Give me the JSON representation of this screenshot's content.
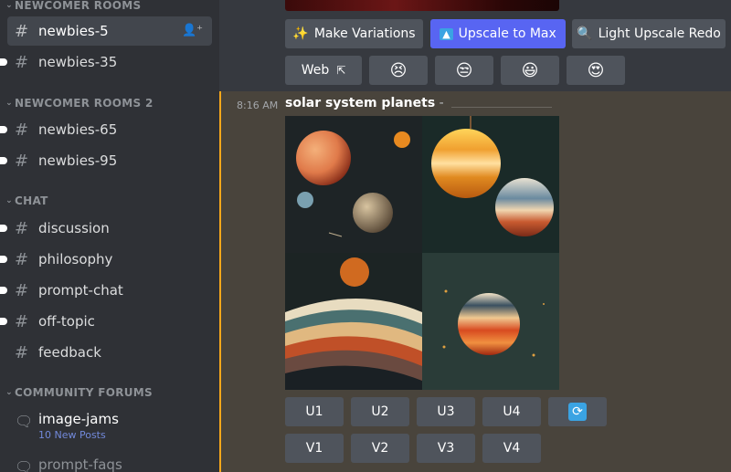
{
  "sidebar": {
    "categories": [
      {
        "label": "NEWCOMER ROOMS"
      },
      {
        "label": "NEWCOMER ROOMS 2"
      },
      {
        "label": "CHAT"
      },
      {
        "label": "COMMUNITY FORUMS"
      }
    ],
    "channels": [
      {
        "label": "newbies-5"
      },
      {
        "label": "newbies-35"
      },
      {
        "label": "newbies-65"
      },
      {
        "label": "newbies-95"
      },
      {
        "label": "discussion"
      },
      {
        "label": "philosophy"
      },
      {
        "label": "prompt-chat"
      },
      {
        "label": "off-topic"
      },
      {
        "label": "feedback"
      }
    ],
    "forums": [
      {
        "label": "image-jams",
        "sub": "10 New Posts"
      },
      {
        "label": "prompt-faqs"
      }
    ]
  },
  "message_top": {
    "buttons": {
      "make_variations": "Make Variations",
      "upscale_max": "Upscale to Max",
      "light_upscale": "Light Upscale Redo",
      "web": "Web"
    },
    "reactions": [
      "😣",
      "😒",
      "😃",
      "😍"
    ]
  },
  "message": {
    "time": "8:16 AM",
    "prompt": "solar system planets",
    "separator": "-",
    "buttons": {
      "u1": "U1",
      "u2": "U2",
      "u3": "U3",
      "u4": "U4",
      "v1": "V1",
      "v2": "V2",
      "v3": "V3",
      "v4": "V4"
    }
  },
  "colors": {
    "sidebar_bg": "#2f3136",
    "main_bg": "#36393f",
    "highlight_bg": "#49443c",
    "highlight_border": "#faa81a",
    "button_gray": "#4f545c",
    "button_primary": "#5865f2",
    "link_blue": "#7289da"
  },
  "icons": {
    "channel": "hashtag-icon",
    "forum": "chat-bubble-icon",
    "add_user": "add-user-icon",
    "sparkle": "sparkle-icon",
    "upscale": "upscale-arrow-icon",
    "magnifier": "magnifier-icon",
    "external_link": "external-link-icon",
    "reroll": "reroll-icon"
  }
}
